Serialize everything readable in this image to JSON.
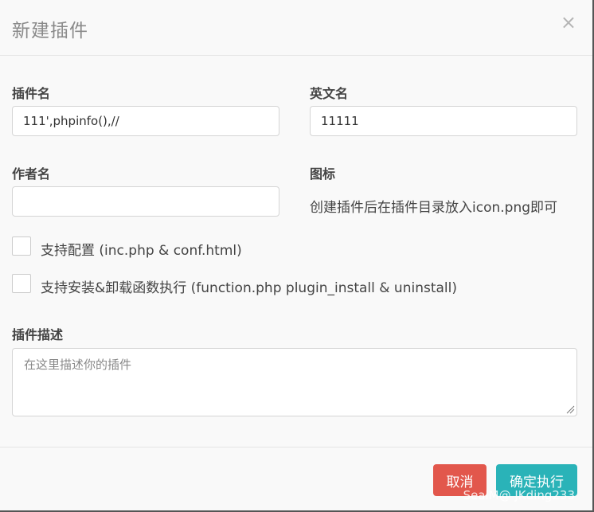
{
  "dialog": {
    "title": "新建插件",
    "close_glyph": "×"
  },
  "form": {
    "plugin_name": {
      "label": "插件名",
      "value": "111',phpinfo(),//"
    },
    "english_name": {
      "label": "英文名",
      "value": "11111"
    },
    "author": {
      "label": "作者名",
      "value": ""
    },
    "icon": {
      "label": "图标",
      "hint": "创建插件后在插件目录放入icon.png即可"
    },
    "checkboxes": [
      {
        "label": "支持配置 (inc.php & conf.html)",
        "checked": false
      },
      {
        "label": "支持安装&卸载函数执行 (function.php plugin_install & uninstall)",
        "checked": false
      }
    ],
    "description": {
      "label": "插件描述",
      "placeholder": "在这里描述你的插件",
      "value": ""
    }
  },
  "footer": {
    "cancel_label": "取消",
    "confirm_label": "确定执行",
    "watermark": "SealM@ JKding233"
  },
  "colors": {
    "cancel": "#e2574c",
    "confirm": "#2ab3b8"
  }
}
